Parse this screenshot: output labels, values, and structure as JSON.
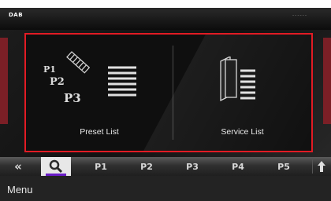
{
  "header": {
    "source": "DAB",
    "status": "------"
  },
  "tiles": [
    {
      "label": "Preset List",
      "icon_labels": [
        "P1",
        "P2",
        "P3"
      ]
    },
    {
      "label": "Service List"
    }
  ],
  "bottom_bar": {
    "back_glyph": "«",
    "presets": [
      "P1",
      "P2",
      "P3",
      "P4",
      "P5"
    ]
  },
  "menu": {
    "label": "Menu"
  },
  "colors": {
    "highlight_border": "#e21b24",
    "search_accent": "#6a1cc7"
  }
}
